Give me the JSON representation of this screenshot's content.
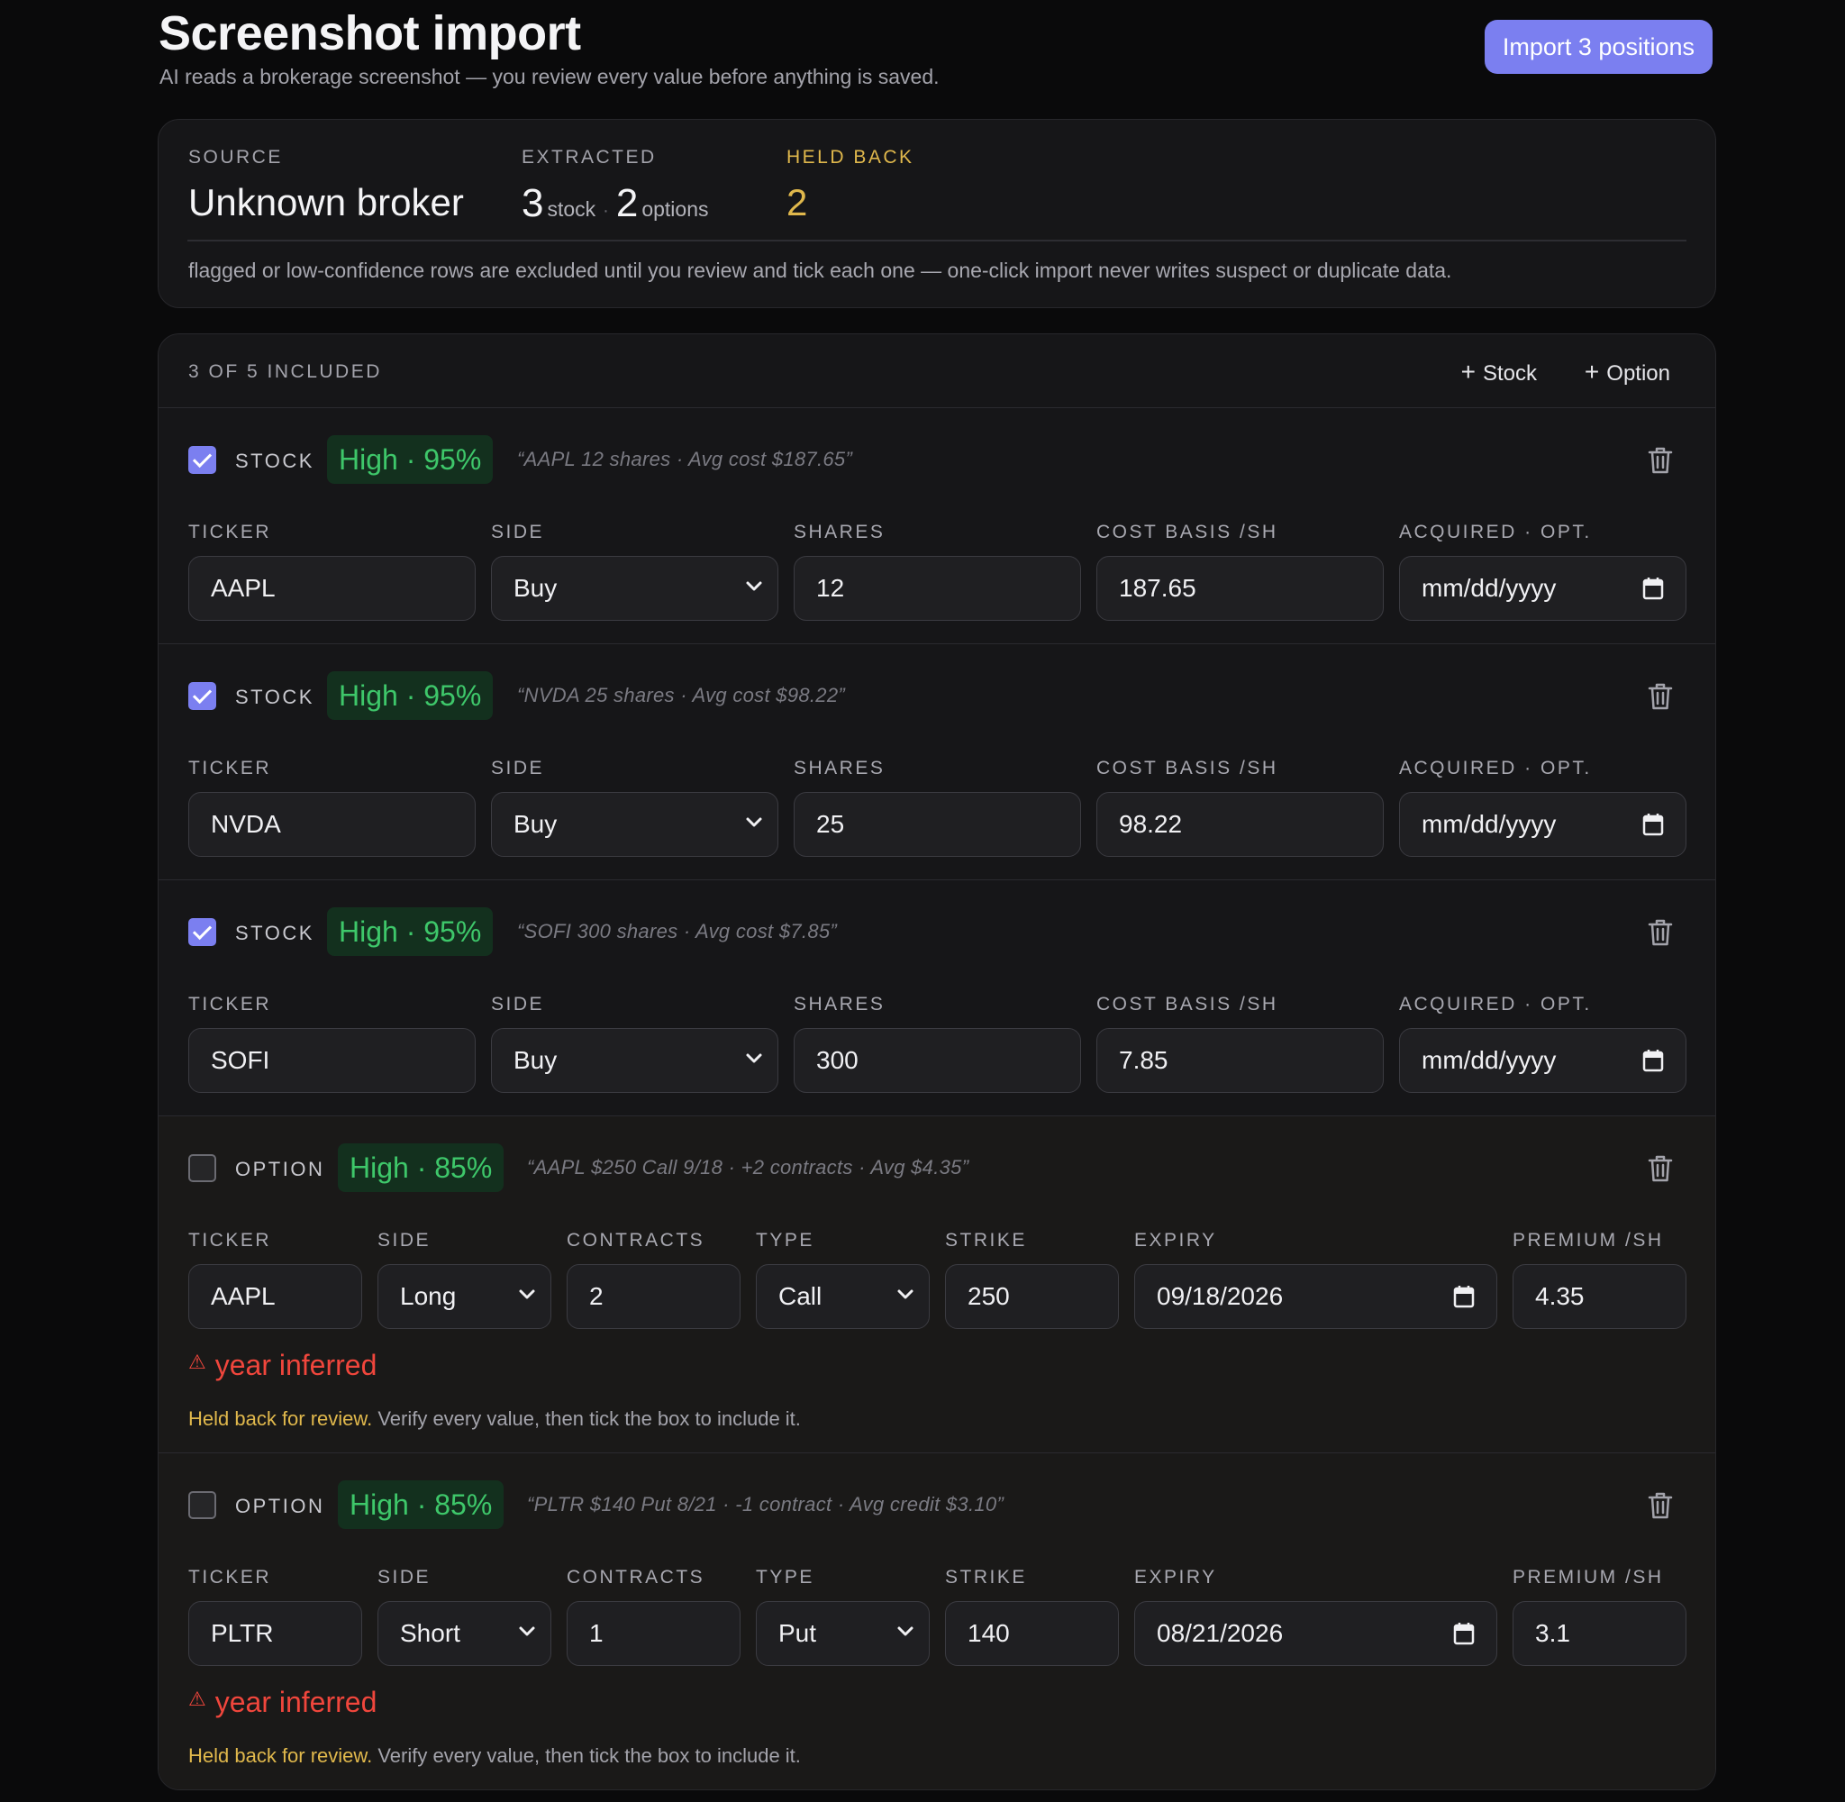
{
  "header": {
    "title": "Screenshot import",
    "subtitle": "AI reads a brokerage screenshot — you review every value before anything is saved.",
    "import_button": "Import 3 positions"
  },
  "summary": {
    "source_label": "SOURCE",
    "source_value": "Unknown broker",
    "extracted_label": "EXTRACTED",
    "stock_count": "3",
    "stock_unit": "stock",
    "separator": "·",
    "option_count": "2",
    "option_unit": "options",
    "held_label": "HELD BACK",
    "held_value": "2",
    "note": "flagged or low-confidence rows are excluded until you review and tick each one — one-click import never writes suspect or duplicate data."
  },
  "list": {
    "count_label": "3 OF 5 INCLUDED",
    "add_stock": "Stock",
    "add_option": "Option"
  },
  "stock_labels": {
    "ticker": "TICKER",
    "side": "SIDE",
    "shares": "SHARES",
    "cost": "COST BASIS /SH",
    "acquired": "ACQUIRED · OPT."
  },
  "option_labels": {
    "ticker": "TICKER",
    "side": "SIDE",
    "contracts": "CONTRACTS",
    "type": "TYPE",
    "strike": "STRIKE",
    "expiry": "EXPIRY",
    "premium": "PREMIUM /SH"
  },
  "rows": [
    {
      "kind": "STOCK",
      "included": true,
      "confidence": "High · 95%",
      "quote": "“AAPL 12 shares · Avg cost $187.65”",
      "ticker": "AAPL",
      "side": "Buy",
      "shares": "12",
      "cost": "187.65",
      "acquired": "mm/dd/yyyy"
    },
    {
      "kind": "STOCK",
      "included": true,
      "confidence": "High · 95%",
      "quote": "“NVDA 25 shares · Avg cost $98.22”",
      "ticker": "NVDA",
      "side": "Buy",
      "shares": "25",
      "cost": "98.22",
      "acquired": "mm/dd/yyyy"
    },
    {
      "kind": "STOCK",
      "included": true,
      "confidence": "High · 95%",
      "quote": "“SOFI 300 shares · Avg cost $7.85”",
      "ticker": "SOFI",
      "side": "Buy",
      "shares": "300",
      "cost": "7.85",
      "acquired": "mm/dd/yyyy"
    },
    {
      "kind": "OPTION",
      "included": false,
      "confidence": "High · 85%",
      "quote": "“AAPL $250 Call 9/18 · +2 contracts · Avg $4.35”",
      "ticker": "AAPL",
      "side": "Long",
      "contracts": "2",
      "type": "Call",
      "strike": "250",
      "expiry": "09/18/2026",
      "premium": "4.35",
      "warning": "year inferred",
      "held_strong": "Held back for review.",
      "held_rest": " Verify every value, then tick the box to include it."
    },
    {
      "kind": "OPTION",
      "included": false,
      "confidence": "High · 85%",
      "quote": "“PLTR $140 Put 8/21 · -1 contract · Avg credit $3.10”",
      "ticker": "PLTR",
      "side": "Short",
      "contracts": "1",
      "type": "Put",
      "strike": "140",
      "expiry": "08/21/2026",
      "premium": "3.1",
      "warning": "year inferred",
      "held_strong": "Held back for review.",
      "held_rest": " Verify every value, then tick the box to include it."
    }
  ],
  "colors": {
    "accent": "#7b7ff0",
    "confidence_green": "#3ec76a",
    "warning_yellow": "#e0b84c",
    "error_red": "#f0463c"
  },
  "icons": {
    "delete": "trash-icon",
    "select_caret": "chevron-down-icon",
    "date_picker": "calendar-icon",
    "warning": "warning-triangle-icon",
    "add": "plus-icon"
  }
}
